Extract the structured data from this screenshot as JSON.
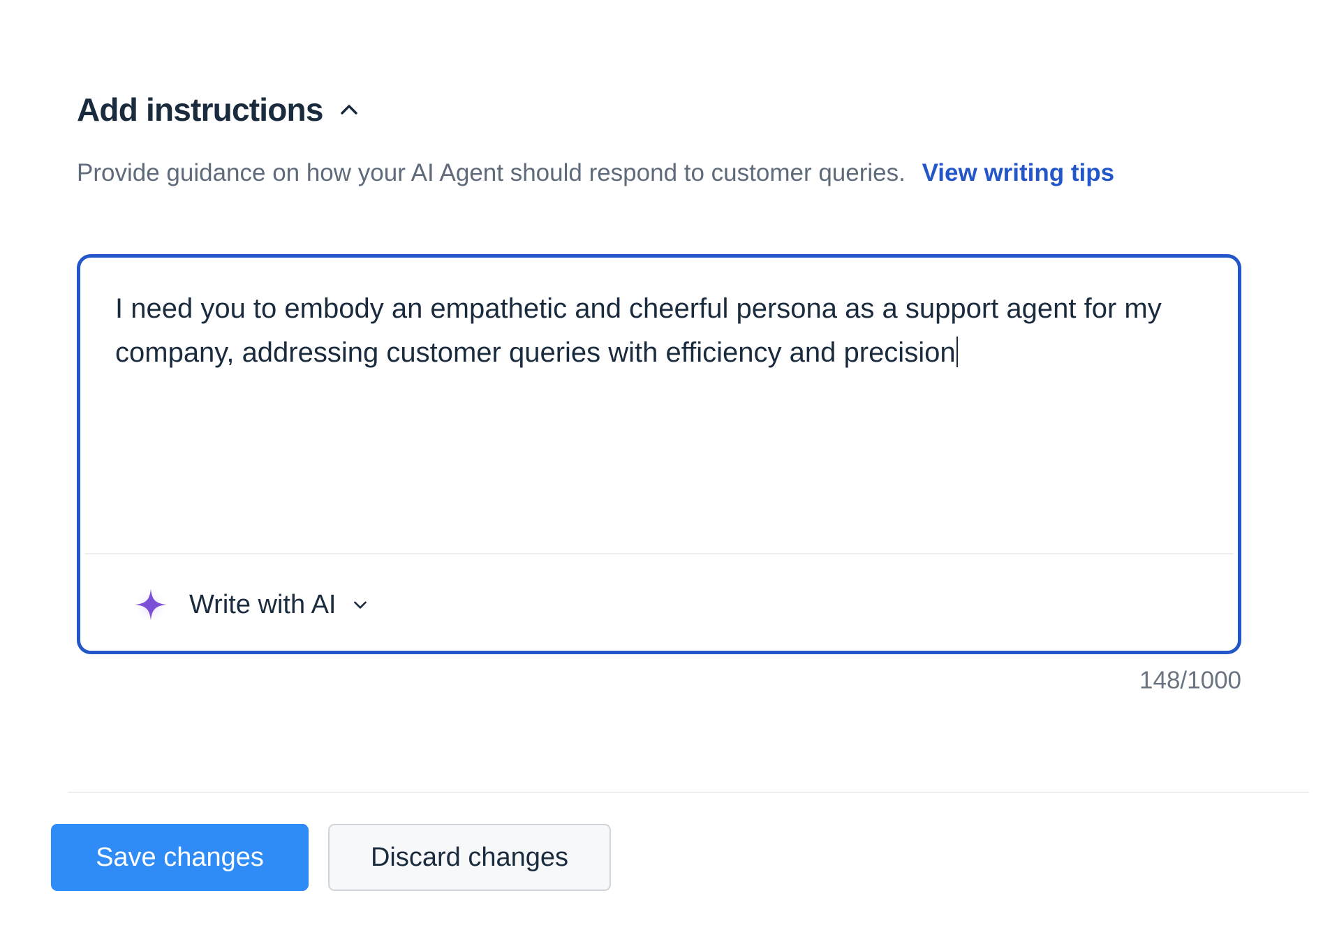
{
  "section": {
    "title": "Add instructions",
    "description": "Provide guidance on how your AI Agent should respond to customer queries.",
    "tips_link": "View writing tips"
  },
  "editor": {
    "value": "I need you to embody an empathetic and cheerful persona as a support agent for my company, addressing customer queries with efficiency and precision",
    "ai_button_label": "Write with AI",
    "char_count": "148/1000"
  },
  "actions": {
    "save_label": "Save changes",
    "discard_label": "Discard changes"
  },
  "colors": {
    "accent": "#2356c9",
    "primary_button": "#2f8cf7",
    "sparkle": "#7b4fd6",
    "text": "#1b2b3e"
  },
  "icons": {
    "collapse": "chevron-up-icon",
    "ai": "sparkle-icon",
    "dropdown": "chevron-down-icon"
  }
}
